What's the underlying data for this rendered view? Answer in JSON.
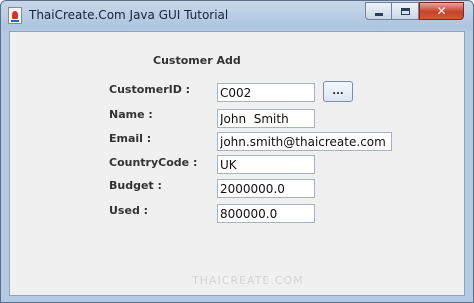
{
  "window": {
    "title": "ThaiCreate.Com Java GUI Tutorial",
    "app_icon": "java-cup-icon",
    "controls": {
      "minimize_icon": "minimize-icon",
      "maximize_icon": "maximize-icon",
      "close_icon": "close-icon",
      "close_glyph": "✕"
    }
  },
  "form": {
    "heading": "Customer Add",
    "fields": {
      "customer_id": {
        "label": "CustomerID :",
        "value": "C002"
      },
      "name": {
        "label": "Name :",
        "value": "John  Smith"
      },
      "email": {
        "label": "Email :",
        "value": "john.smith@thaicreate.com"
      },
      "country_code": {
        "label": "CountryCode :",
        "value": "UK"
      },
      "budget": {
        "label": "Budget :",
        "value": "2000000.0"
      },
      "used": {
        "label": "Used :",
        "value": "800000.0"
      }
    },
    "lookup_button_label": "..."
  },
  "watermark": "THAICREATE.COM",
  "colors": {
    "panel_background": "#f0f0f0",
    "title_bar": "#bcd0e6",
    "close_button": "#c7432a",
    "label_text": "#333333"
  }
}
